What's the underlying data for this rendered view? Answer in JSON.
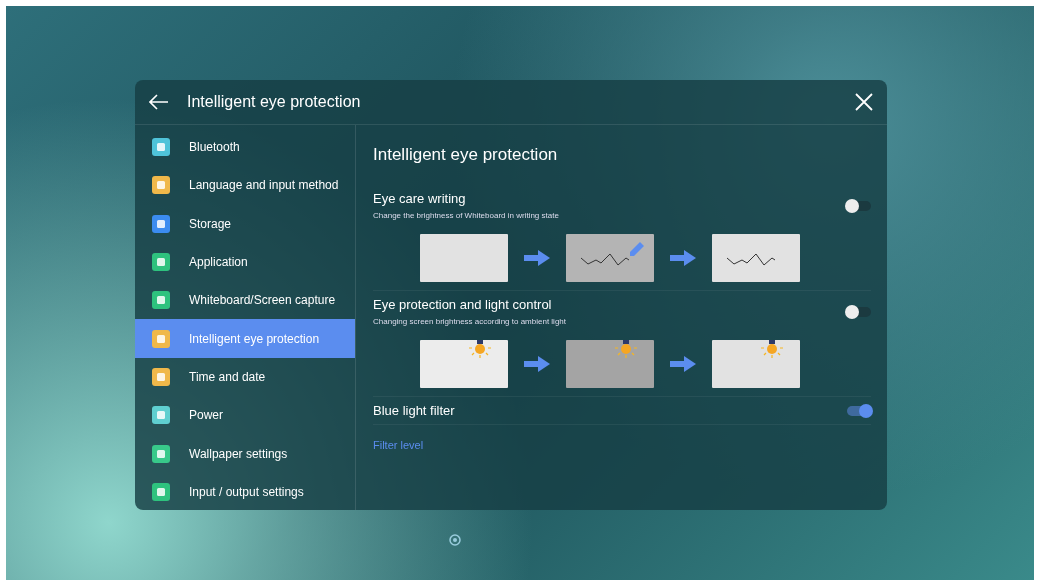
{
  "window": {
    "title": "Intelligent eye protection"
  },
  "sidebar": {
    "items": [
      {
        "label": "Bluetooth",
        "color": "#4fc3d9",
        "selected": false
      },
      {
        "label": "Language and input method",
        "color": "#f0b84a",
        "selected": false
      },
      {
        "label": "Storage",
        "color": "#3b8cf0",
        "selected": false
      },
      {
        "label": "Application",
        "color": "#2ec27e",
        "selected": false
      },
      {
        "label": "Whiteboard/Screen capture",
        "color": "#2ec27e",
        "selected": false
      },
      {
        "label": "Intelligent eye protection",
        "color": "#f0b84a",
        "selected": true
      },
      {
        "label": "Time and date",
        "color": "#f0b84a",
        "selected": false
      },
      {
        "label": "Power",
        "color": "#5fcfd0",
        "selected": false
      },
      {
        "label": "Wallpaper settings",
        "color": "#38c98a",
        "selected": false
      },
      {
        "label": "Input / output settings",
        "color": "#2ec27e",
        "selected": false
      }
    ]
  },
  "content": {
    "heading": "Intelligent eye protection",
    "settings": [
      {
        "kind": "writing",
        "title": "Eye care writing",
        "description": "Change the brightness of Whiteboard in writing state",
        "on": false
      },
      {
        "kind": "light",
        "title": "Eye protection and light control",
        "description": "Changing screen brightness according to ambient light",
        "on": false
      },
      {
        "kind": "plain",
        "title": "Blue light filter",
        "on": true
      }
    ],
    "filter_label": "Filter level"
  }
}
